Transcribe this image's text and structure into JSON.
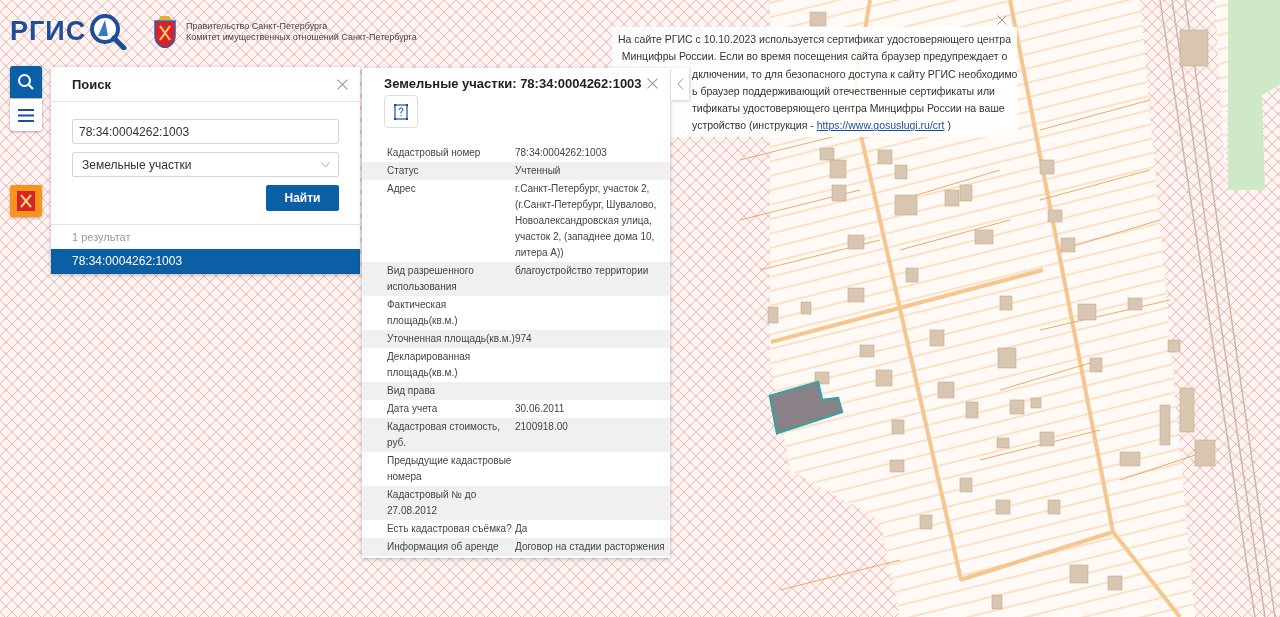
{
  "header": {
    "logo_text": "РГИС",
    "org_lines": [
      "Правительство Санкт-Петербурга",
      "Комитет имущественных отношений Санкт-Петербурга"
    ]
  },
  "search_panel": {
    "title": "Поиск",
    "query": "78:34:0004262:1003",
    "category": "Земельные участки",
    "button": "Найти",
    "result_count": "1 результат",
    "results": [
      {
        "label": "78:34:0004262:1003",
        "selected": true
      }
    ]
  },
  "info_panel": {
    "title": "Земельные участки: 78:34:0004262:1003",
    "rows": [
      {
        "label": "Кадастровый номер",
        "value": "78:34:0004262:1003"
      },
      {
        "label": "Статус",
        "value": "Учтенный"
      },
      {
        "label": "Адрес",
        "value": "г.Санкт-Петербург, участок 2, (г.Санкт-Петербург, Шувалово, Новоалександровская улица, участок 2, (западнее дома 10, литера А))"
      },
      {
        "label": "Вид разрешенного использования",
        "value": "благоустройство территории"
      },
      {
        "label": "Фактическая площадь(кв.м.)"
      },
      {
        "label": "Уточненная площадь(кв.м.)",
        "value": "974"
      },
      {
        "label": "Декларированная площадь(кв.м.)"
      },
      {
        "label": "Вид права"
      },
      {
        "label": "Дата учета",
        "value": "30.06.2011"
      },
      {
        "label": "Кадастровая стоимость, руб.",
        "value": "2100918.00"
      },
      {
        "label": "Предыдущие кадастровые номера"
      },
      {
        "label": "Кадастровый № до 27.08.2012"
      },
      {
        "label": "Есть кадастровая съёмка?",
        "value": "Да"
      },
      {
        "label": "Информация об аренде",
        "value": "Договор на стадии расторжения"
      }
    ]
  },
  "notice": {
    "lines": [
      "На сайте РГИС с 10.10.2023 используется сертификат удостоверяющего центра",
      "Минцифры России. Если во время посещения сайта браузер предупреждает о"
    ],
    "covered_lines": [
      "дключении, то для безопасного доступа к сайту РГИС необходимо",
      "ь браузер поддерживающий отечественные сертификаты или",
      "тификаты удостоверяющего центра Минцифры России на ваше"
    ],
    "last_line_prefix": "устройство (инструкция - ",
    "link": "https://www.gosuslugi.ru/crt",
    "last_line_suffix": " )"
  }
}
